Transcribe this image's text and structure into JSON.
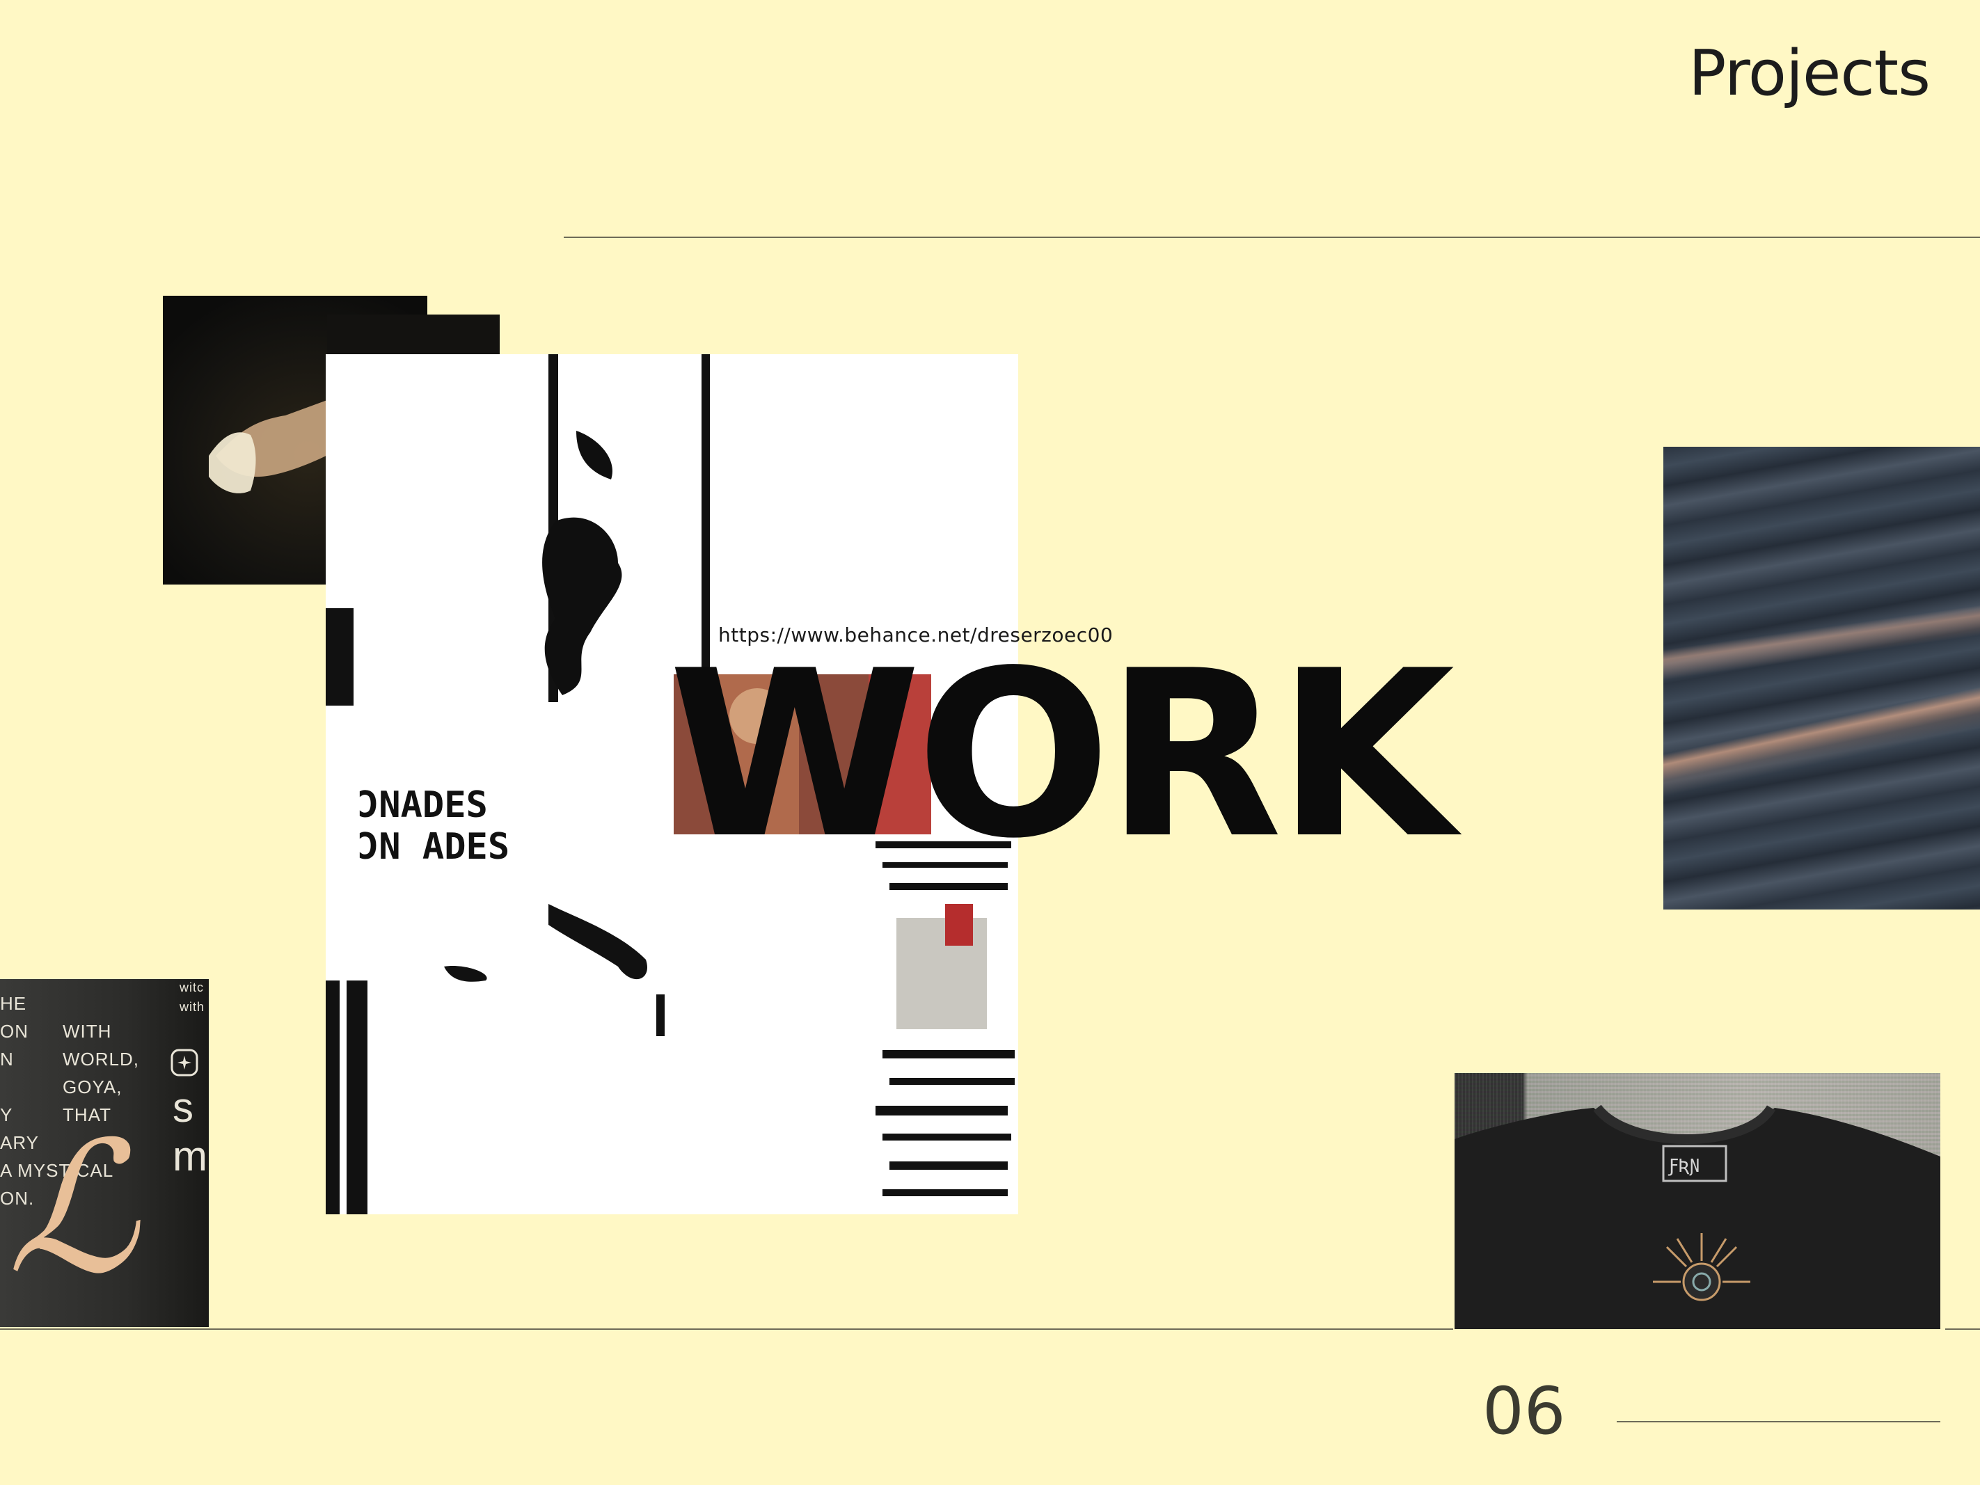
{
  "header": {
    "section_title": "Projects"
  },
  "feature": {
    "link": "https://www.behance.net/dreserzoec00",
    "headline": "WORK"
  },
  "collage": {
    "glitch_word_top": "ƆNADES",
    "glitch_word_bottom": "ƆN ADES"
  },
  "poster": {
    "lines_left": "HE\nON\nN\n\nY\nARY\nA MYSTICAL\nON.",
    "lines_right": "WITH\nWORLD,\nGOYA,\nTHAT",
    "top_small_1": "witc",
    "top_small_2": "with",
    "big_letters": "s\nm"
  },
  "footer": {
    "page_number": "06"
  },
  "colors": {
    "background": "#fff8c5",
    "text": "#1c1c1c",
    "rule": "#6e6b58"
  }
}
